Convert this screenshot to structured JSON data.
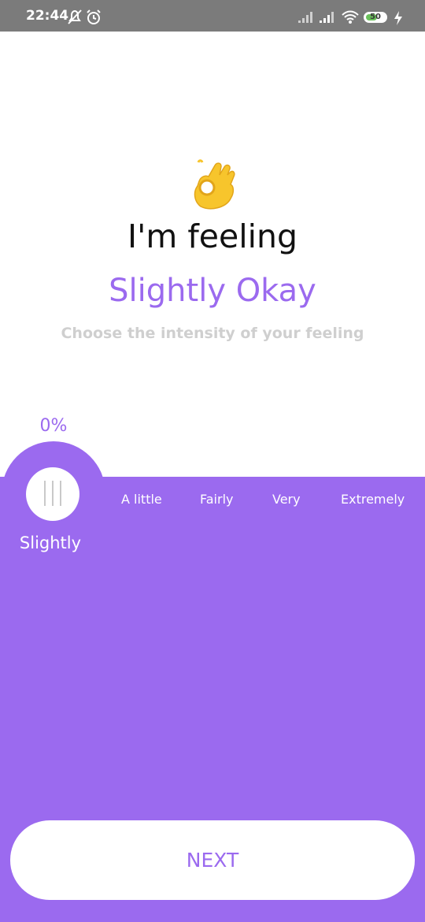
{
  "status_bar": {
    "time": "22:44",
    "battery": "50",
    "icons": [
      "mute-icon",
      "alarm-icon",
      "signal-icon",
      "signal-icon",
      "wifi-icon",
      "battery-icon",
      "charging-icon"
    ]
  },
  "mood": {
    "emoji": "ok-hand-emoji",
    "title": "I'm feeling",
    "value": "Slightly Okay",
    "subtitle": "Choose the intensity of your feeling"
  },
  "intensity": {
    "percent_label": "0%",
    "percent_value": 0,
    "selected_level": "Slightly",
    "levels": [
      "A little",
      "Fairly",
      "Very",
      "Extremely"
    ]
  },
  "actions": {
    "next_label": "NEXT"
  },
  "colors": {
    "accent": "#9b6aef",
    "subtitle": "#cfcfcf",
    "status_bar": "#7b7b7b"
  }
}
